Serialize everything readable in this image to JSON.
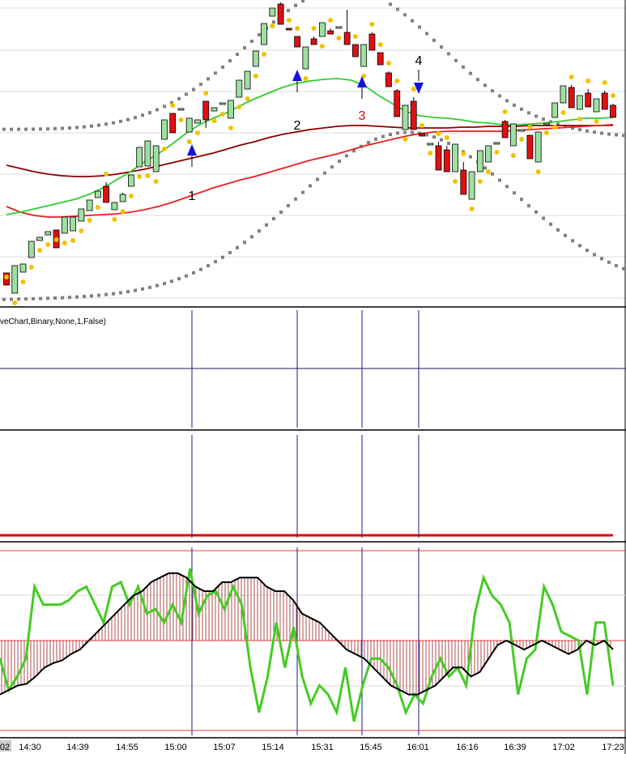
{
  "panel2_label": "veChart,Binary,None,1,False)",
  "x_axis_labels": [
    "02",
    "14:30",
    "14:39",
    "14:55",
    "15:00",
    "15:07",
    "15:14",
    "15:31",
    "15:45",
    "16:01",
    "16:16",
    "16:39",
    "17:02",
    "17:23"
  ],
  "markers": [
    {
      "label": "1",
      "type": "up-arrow",
      "color": "#000000"
    },
    {
      "label": "2",
      "type": "up-arrow",
      "color": "#000000"
    },
    {
      "label": "3",
      "type": "up-arrow",
      "color": "#e00000"
    },
    {
      "label": "4",
      "type": "down-arrow",
      "color": "#000000"
    }
  ],
  "colors": {
    "bull_candle": "#9fe09f",
    "bear_candle": "#e01010",
    "psar_dots": "#f2c200",
    "band_dots": "#808080",
    "fast_ma": "#33cc33",
    "mid_ma": "#e82020",
    "slow_ma": "#8b0000",
    "arrow": "#1010e0",
    "osc_green": "#44cc22",
    "osc_black": "#000000",
    "histogram": "#8b0000",
    "binary_line": "#e00000"
  },
  "chart_data": [
    {
      "type": "candlestick",
      "title": "",
      "candles": [
        {
          "o": 352,
          "h": 355,
          "l": 340,
          "c": 337,
          "bull": false
        },
        {
          "o": 362,
          "h": 364,
          "l": 324,
          "c": 328,
          "bull": true
        },
        {
          "o": 336,
          "h": 342,
          "l": 322,
          "c": 326,
          "bull": true
        },
        {
          "o": 318,
          "h": 328,
          "l": 295,
          "c": 298,
          "bull": true
        },
        {
          "o": 297,
          "h": 297,
          "l": 290,
          "c": 293,
          "bull": true
        },
        {
          "o": 290,
          "h": 305,
          "l": 283,
          "c": 286,
          "bull": true
        },
        {
          "o": 306,
          "h": 308,
          "l": 268,
          "c": 284,
          "bull": false
        },
        {
          "o": 288,
          "h": 292,
          "l": 262,
          "c": 268,
          "bull": true
        },
        {
          "o": 285,
          "h": 287,
          "l": 262,
          "c": 268,
          "bull": true
        },
        {
          "o": 273,
          "h": 275,
          "l": 253,
          "c": 258,
          "bull": true
        },
        {
          "o": 260,
          "h": 262,
          "l": 244,
          "c": 247,
          "bull": true
        },
        {
          "o": 244,
          "h": 242,
          "l": 236,
          "c": 236,
          "bull": true
        },
        {
          "o": 230,
          "h": 225,
          "l": 217,
          "c": 250,
          "bull": false
        },
        {
          "o": 259,
          "h": 257,
          "l": 248,
          "c": 250,
          "bull": true
        },
        {
          "o": 249,
          "h": 238,
          "l": 235,
          "c": 240,
          "bull": true
        },
        {
          "o": 230,
          "h": 226,
          "l": 211,
          "c": 216,
          "bull": true
        },
        {
          "o": 206,
          "h": 209,
          "l": 181,
          "c": 182,
          "bull": true
        },
        {
          "o": 205,
          "h": 205,
          "l": 169,
          "c": 174,
          "bull": true
        },
        {
          "o": 212,
          "h": 214,
          "l": 175,
          "c": 180,
          "bull": true
        },
        {
          "o": 172,
          "h": 175,
          "l": 144,
          "c": 148,
          "bull": true
        },
        {
          "o": 140,
          "h": 142,
          "l": 124,
          "c": 164,
          "bull": false
        },
        {
          "o": 136,
          "h": 140,
          "l": 130,
          "c": 134,
          "bull": true
        },
        {
          "o": 163,
          "h": 165,
          "l": 144,
          "c": 146,
          "bull": true
        },
        {
          "o": 152,
          "h": 154,
          "l": 144,
          "c": 148,
          "bull": true
        },
        {
          "o": 125,
          "h": 125,
          "l": 158,
          "c": 148,
          "bull": false
        },
        {
          "o": 137,
          "h": 133,
          "l": 127,
          "c": 133,
          "bull": true
        },
        {
          "o": 129,
          "h": 133,
          "l": 124,
          "c": 127,
          "bull": true
        },
        {
          "o": 146,
          "h": 148,
          "l": 122,
          "c": 124,
          "bull": true
        },
        {
          "o": 120,
          "h": 118,
          "l": 96,
          "c": 99,
          "bull": true
        },
        {
          "o": 110,
          "h": 116,
          "l": 84,
          "c": 88,
          "bull": true
        },
        {
          "o": 82,
          "h": 85,
          "l": 60,
          "c": 63,
          "bull": true
        },
        {
          "o": 55,
          "h": 60,
          "l": 27,
          "c": 29,
          "bull": true
        },
        {
          "o": 20,
          "h": 22,
          "l": 8,
          "c": 10,
          "bull": true
        },
        {
          "o": 5,
          "h": 3,
          "l": 0,
          "c": 30,
          "bull": false
        },
        {
          "o": 35,
          "h": 42,
          "l": 30,
          "c": 37,
          "bull": false
        },
        {
          "o": 45,
          "h": 48,
          "l": 42,
          "c": 58,
          "bull": false
        },
        {
          "o": 85,
          "h": 88,
          "l": 55,
          "c": 58,
          "bull": true
        },
        {
          "o": 48,
          "h": 45,
          "l": 38,
          "c": 55,
          "bull": false
        },
        {
          "o": 45,
          "h": 48,
          "l": 25,
          "c": 28,
          "bull": true
        },
        {
          "o": 42,
          "h": 35,
          "l": 25,
          "c": 38,
          "bull": false
        },
        {
          "o": 35,
          "h": 37,
          "l": 30,
          "c": 33,
          "bull": true
        },
        {
          "o": 40,
          "h": 12,
          "l": 28,
          "c": 55,
          "bull": false
        },
        {
          "o": 55,
          "h": 57,
          "l": 63,
          "c": 70,
          "bull": false
        },
        {
          "o": 82,
          "h": 88,
          "l": 52,
          "c": 55,
          "bull": true
        },
        {
          "o": 42,
          "h": 40,
          "l": 38,
          "c": 62,
          "bull": false
        },
        {
          "o": 65,
          "h": 70,
          "l": 75,
          "c": 80,
          "bull": false
        },
        {
          "o": 90,
          "h": 88,
          "l": 85,
          "c": 107,
          "bull": false
        },
        {
          "o": 112,
          "h": 110,
          "l": 108,
          "c": 144,
          "bull": false
        },
        {
          "o": 160,
          "h": 165,
          "l": 126,
          "c": 130,
          "bull": true
        },
        {
          "o": 125,
          "h": 120,
          "l": 118,
          "c": 160,
          "bull": false
        },
        {
          "o": 165,
          "h": 170,
          "l": 163,
          "c": 168,
          "bull": false
        },
        {
          "o": 177,
          "h": 178,
          "l": 175,
          "c": 177,
          "bull": true
        },
        {
          "o": 180,
          "h": 175,
          "l": 175,
          "c": 210,
          "bull": false
        },
        {
          "o": 185,
          "h": 180,
          "l": 178,
          "c": 212,
          "bull": false
        },
        {
          "o": 212,
          "h": 214,
          "l": 176,
          "c": 178,
          "bull": true
        },
        {
          "o": 210,
          "h": 200,
          "l": 197,
          "c": 240,
          "bull": false
        },
        {
          "o": 246,
          "h": 248,
          "l": 208,
          "c": 212,
          "bull": true
        },
        {
          "o": 212,
          "h": 214,
          "l": 182,
          "c": 186,
          "bull": true
        },
        {
          "o": 200,
          "h": 203,
          "l": 178,
          "c": 180,
          "bull": true
        },
        {
          "o": 176,
          "h": 178,
          "l": 172,
          "c": 176,
          "bull": true
        },
        {
          "o": 150,
          "h": 148,
          "l": 146,
          "c": 170,
          "bull": false
        },
        {
          "o": 180,
          "h": 183,
          "l": 150,
          "c": 153,
          "bull": true
        },
        {
          "o": 160,
          "h": 163,
          "l": 158,
          "c": 162,
          "bull": true
        },
        {
          "o": 167,
          "h": 168,
          "l": 165,
          "c": 196,
          "bull": false
        },
        {
          "o": 200,
          "h": 202,
          "l": 160,
          "c": 163,
          "bull": true
        },
        {
          "o": 152,
          "h": 155,
          "l": 150,
          "c": 153,
          "bull": true
        },
        {
          "o": 145,
          "h": 147,
          "l": 123,
          "c": 127,
          "bull": true
        },
        {
          "o": 127,
          "h": 125,
          "l": 104,
          "c": 106,
          "bull": true
        },
        {
          "o": 108,
          "h": 105,
          "l": 101,
          "c": 133,
          "bull": false
        },
        {
          "o": 135,
          "h": 137,
          "l": 115,
          "c": 118,
          "bull": true
        },
        {
          "o": 115,
          "h": 110,
          "l": 106,
          "c": 132,
          "bull": false
        },
        {
          "o": 138,
          "h": 140,
          "l": 119,
          "c": 122,
          "bull": true
        },
        {
          "o": 115,
          "h": 112,
          "l": 110,
          "c": 135,
          "bull": false
        },
        {
          "o": 130,
          "h": 128,
          "l": 127,
          "c": 145,
          "bull": false
        }
      ],
      "fast_ma": [
        265,
        262,
        258,
        254,
        250,
        246,
        240,
        232,
        222,
        212,
        200,
        190,
        178,
        165,
        154,
        146,
        139,
        130,
        122,
        115,
        108,
        103,
        100,
        98,
        97,
        99,
        106,
        118,
        128,
        138,
        143,
        145,
        146,
        148,
        151,
        152,
        154,
        154,
        153,
        152,
        150,
        148,
        146,
        146,
        145
      ],
      "mid_ma": [
        255,
        262,
        266,
        268,
        268,
        267,
        266,
        265,
        264,
        262,
        259,
        255,
        250,
        244,
        238,
        232,
        227,
        222,
        218,
        213,
        208,
        203,
        198,
        194,
        190,
        185,
        180,
        176,
        172,
        168,
        165,
        163,
        162,
        162,
        162,
        162,
        162,
        161,
        160,
        159,
        158,
        157,
        156,
        155,
        155
      ],
      "slow_ma": [
        204,
        208,
        212,
        215,
        217,
        218,
        218,
        217,
        215,
        212,
        209,
        205,
        201,
        197,
        193,
        189,
        184,
        179,
        175,
        170,
        166,
        163,
        160,
        158,
        156,
        155,
        155,
        156,
        157,
        158,
        158,
        158,
        158,
        157,
        157,
        156,
        156,
        156,
        155,
        155,
        155,
        155,
        155,
        155,
        154
      ],
      "marker_positions": [
        {
          "label": "1",
          "dir": "up"
        },
        {
          "label": "2",
          "dir": "up"
        },
        {
          "label": "3",
          "dir": "up"
        },
        {
          "label": "4",
          "dir": "down"
        }
      ]
    },
    {
      "type": "line",
      "title": "",
      "series": [
        {
          "values": [
            0.5,
            0.5,
            0.5,
            0.5,
            0.5,
            0.5,
            0.5,
            0.5,
            0.5,
            0.5
          ]
        }
      ]
    },
    {
      "type": "line",
      "title": "",
      "series": [
        {
          "values": [
            0,
            0,
            0,
            0,
            0,
            0,
            0,
            0,
            0,
            0
          ]
        }
      ]
    },
    {
      "type": "line",
      "title": "",
      "ylim": [
        -100,
        100
      ],
      "series": [
        {
          "values": [
            -20,
            -55,
            -40,
            -20,
            60,
            40,
            40,
            40,
            45,
            55,
            60,
            40,
            20,
            60,
            65,
            40,
            60,
            30,
            35,
            20,
            40,
            20,
            80,
            30,
            50,
            55,
            35,
            60,
            40,
            -30,
            -80,
            -40,
            20,
            -30,
            15,
            -40,
            -70,
            -50,
            -60,
            -80,
            -30,
            -90,
            -50,
            -20,
            -20,
            -30,
            -50,
            -80,
            -60,
            -70,
            -40,
            -20,
            -40,
            -30,
            -50,
            30,
            70,
            50,
            40,
            20,
            -60,
            -20,
            -10,
            60,
            40,
            10,
            5,
            0,
            -60,
            20,
            20,
            -50
          ]
        },
        {
          "values": [
            -60,
            -55,
            -50,
            -48,
            -40,
            -30,
            -25,
            -22,
            -15,
            -10,
            0,
            10,
            20,
            30,
            40,
            50,
            55,
            65,
            70,
            75,
            75,
            70,
            60,
            55,
            55,
            65,
            65,
            70,
            70,
            70,
            60,
            55,
            55,
            45,
            30,
            25,
            20,
            10,
            0,
            -10,
            -15,
            -20,
            -30,
            -40,
            -50,
            -55,
            -60,
            -60,
            -55,
            -50,
            -40,
            -30,
            -30,
            -40,
            -35,
            -20,
            -5,
            0,
            -5,
            -10,
            -5,
            0,
            -5,
            -10,
            -15,
            -10,
            0,
            -5,
            0,
            -10
          ]
        }
      ]
    }
  ]
}
